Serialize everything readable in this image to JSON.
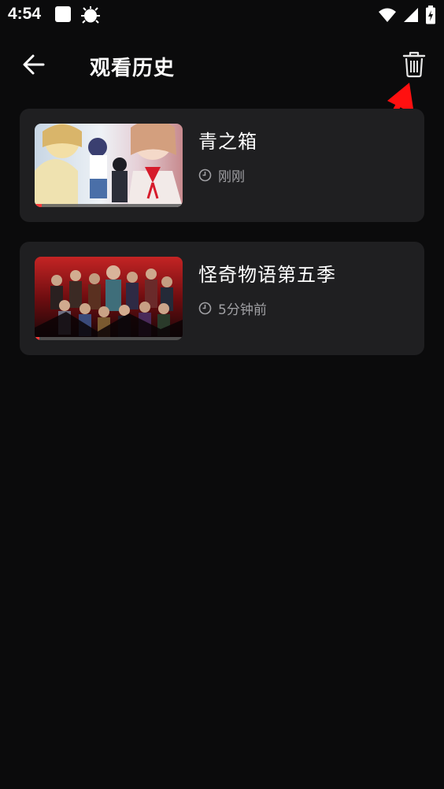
{
  "status_bar": {
    "time": "4:54",
    "icons": [
      "notification-square-icon",
      "bug-icon",
      "wifi-icon",
      "signal-icon",
      "battery-charging-icon"
    ]
  },
  "app_bar": {
    "title": "观看历史",
    "back_icon": "arrow-left-icon",
    "action_icon": "trash-icon"
  },
  "history": [
    {
      "title": "青之箱",
      "time_text": "刚刚",
      "progress": 0.05,
      "thumb": "anime-students-poster"
    },
    {
      "title": "怪奇物语第五季",
      "time_text": "5分钟前",
      "progress": 0.03,
      "thumb": "stranger-things-poster"
    }
  ],
  "colors": {
    "background": "#0b0b0c",
    "card": "#1f1f21",
    "meta_text": "#a0a0a4",
    "progress": "#ff3b3b",
    "annotation_arrow": "#ff1010"
  }
}
